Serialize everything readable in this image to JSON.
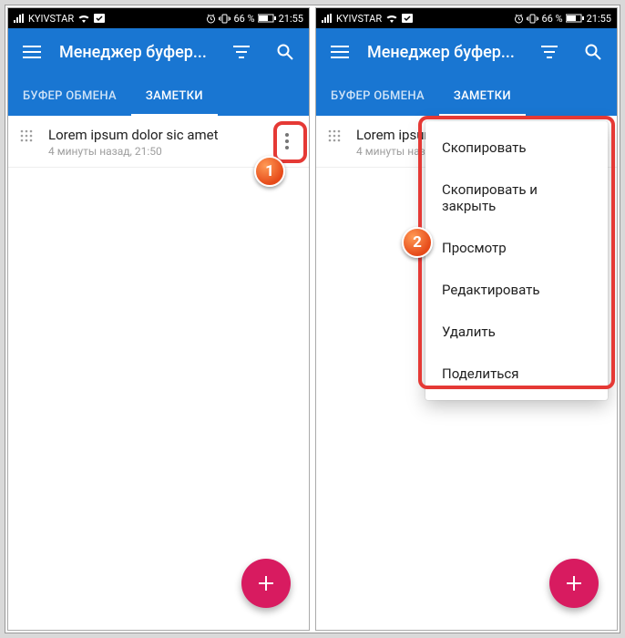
{
  "statusbar": {
    "carrier": "KYIVSTAR",
    "percent": "66 %",
    "time": "21:55"
  },
  "appbar": {
    "title": "Менеджер буфер..."
  },
  "tabs": {
    "clipboard": "БУФЕР ОБМЕНА",
    "notes": "ЗАМЕТКИ"
  },
  "note": {
    "title": "Lorem ipsum dolor sic amet",
    "title_truncated": "Lorem ipsum do",
    "time": "4 минуты назад, 21:50",
    "time_truncated": "4 минуты назад, 21"
  },
  "menu": {
    "copy": "Скопировать",
    "copy_close": "Скопировать и закрыть",
    "view": "Просмотр",
    "edit": "Редактировать",
    "delete": "Удалить",
    "share": "Поделиться"
  },
  "steps": {
    "one": "1",
    "two": "2"
  }
}
